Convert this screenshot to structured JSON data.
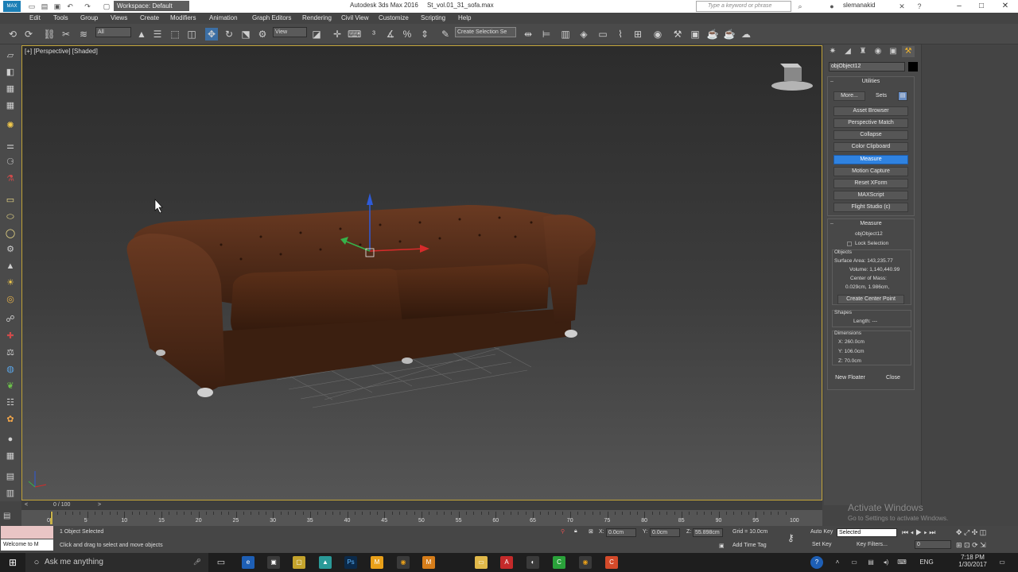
{
  "titlebar": {
    "workspace": "Workspace: Default",
    "app_title": "Autodesk 3ds Max 2016",
    "file_name": "St_vol.01_31_sofa.max",
    "search_placeholder": "Type a keyword or phrase",
    "username": "slemanakid",
    "app_icon_text": "MAX"
  },
  "menu": [
    "Edit",
    "Tools",
    "Group",
    "Views",
    "Create",
    "Modifiers",
    "Animation",
    "Graph Editors",
    "Rendering",
    "Civil View",
    "Customize",
    "Scripting",
    "Help"
  ],
  "toolbar": {
    "selection_filter": "All",
    "ref_coord": "View",
    "selection_set": "Create Selection Se"
  },
  "viewport": {
    "label": "[+] [Perspective] [Shaded]"
  },
  "command_panel": {
    "object_name": "objObject12",
    "utilities_title": "Utilities",
    "more_label": "More...",
    "sets_label": "Sets",
    "utility_buttons": [
      "Asset Browser",
      "Perspective Match",
      "Collapse",
      "Color Clipboard",
      "Measure",
      "Motion Capture",
      "Reset XForm",
      "MAXScript",
      "Flight Studio (c)"
    ],
    "active_utility": "Measure",
    "measure": {
      "title": "Measure",
      "object": "objObject12",
      "lock_selection": "Lock Selection",
      "objects_title": "Objects",
      "surface_area": "Surface Area: 143,235.77",
      "volume": "Volume: 1,140,440.99",
      "center_of_mass_label": "Center of Mass:",
      "center_of_mass_value": "0.029cm, 1.986cm,",
      "create_center_point": "Create Center Point",
      "shapes_title": "Shapes",
      "length": "Length: ---",
      "dimensions_title": "Dimensions",
      "x": "X: 260.0cm",
      "y": "Y: 106.0cm",
      "z": "Z: 70.0cm",
      "new_floater": "New Floater",
      "close": "Close"
    }
  },
  "timeline": {
    "frame": "0 / 100",
    "ticks": [
      "0",
      "5",
      "10",
      "15",
      "20",
      "25",
      "30",
      "35",
      "40",
      "45",
      "50",
      "55",
      "60",
      "65",
      "70",
      "75",
      "80",
      "85",
      "90",
      "95",
      "100"
    ]
  },
  "status": {
    "maxscript_prompt": "Welcome to M",
    "selected": "1 Object Selected",
    "prompt": "Click and drag to select and move objects",
    "x_label": "X:",
    "x_value": "0.0cm",
    "y_label": "Y:",
    "y_value": "0.0cm",
    "z_label": "Z:",
    "z_value": "55.898cm",
    "grid": "Grid = 10.0cm",
    "add_time_tag": "Add Time Tag",
    "auto_key": "Auto Key",
    "set_key": "Set Key",
    "key_mode": "Selected",
    "key_filters": "Key Filters...",
    "frame_field": "0"
  },
  "watermark": {
    "line1": "Activate Windows",
    "line2": "Go to Settings to activate Windows."
  },
  "taskbar": {
    "ask": "Ask me anything",
    "lang": "ENG",
    "time": "7:18 PM",
    "date": "1/30/2017"
  }
}
